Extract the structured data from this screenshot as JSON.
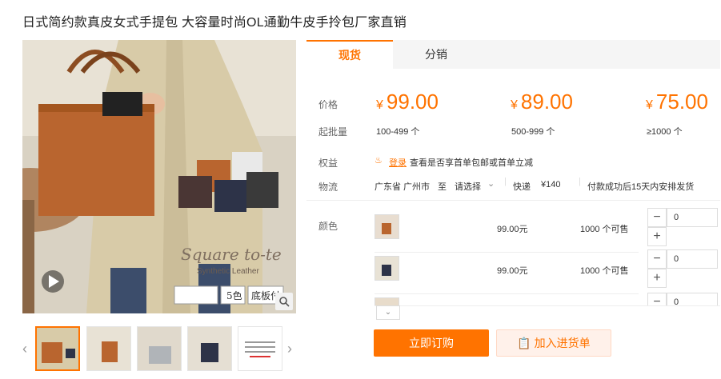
{
  "title": "日式简约款真皮女式手提包 大容量时尚OL通勤牛皮手拎包厂家直销",
  "gallery": {
    "overlay_line1": "Square to-te",
    "overlay_line2": "Synthetic Leather",
    "badge_colors": "5色",
    "badge_base": "底板付"
  },
  "tabs": [
    {
      "label": "现货"
    },
    {
      "label": "分销"
    }
  ],
  "pricing": {
    "price_label": "价格",
    "currency": "¥",
    "tiers": [
      {
        "price": "99.00",
        "qty": "100-499 个"
      },
      {
        "price": "89.00",
        "qty": "500-999 个"
      },
      {
        "price": "75.00",
        "qty": "≥1000 个"
      }
    ],
    "moq_label": "起批量"
  },
  "benefits": {
    "label": "权益",
    "login": "登录",
    "text": "查看是否享首单包邮或首单立减"
  },
  "logistics": {
    "label": "物流",
    "from": "广东省 广州市",
    "to": "至",
    "select": "请选择",
    "method": "快递",
    "fee": "¥140",
    "note": "付款成功后15天内安排发货"
  },
  "sku": {
    "label": "颜色",
    "items": [
      {
        "price": "99.00元",
        "stock": "1000 个可售",
        "qty": "0"
      },
      {
        "price": "99.00元",
        "stock": "1000 个可售",
        "qty": "0"
      },
      {
        "price": "",
        "stock": "",
        "qty": "0"
      }
    ]
  },
  "actions": {
    "buy": "立即订购",
    "cart": "加入进货单"
  },
  "colors": {
    "accent": "#ff7300"
  }
}
